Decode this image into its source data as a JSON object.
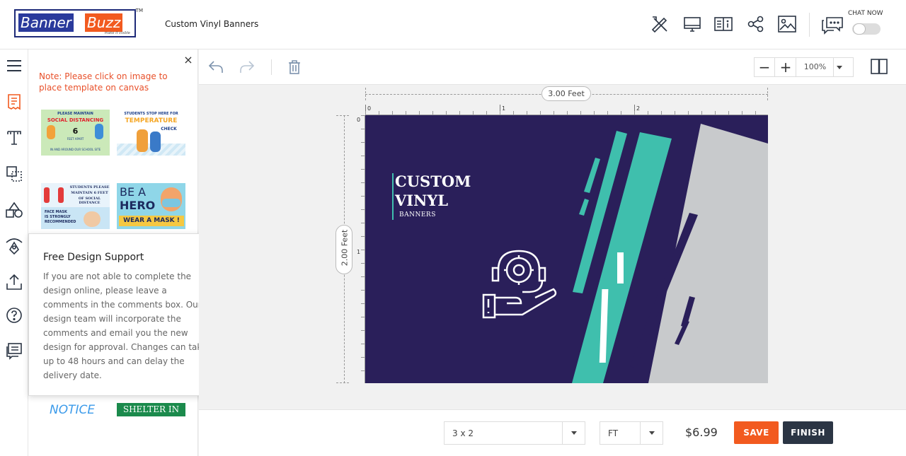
{
  "header": {
    "logo_word1": "Banner",
    "logo_word2": "Buzz",
    "logo_tagline": "make it visible",
    "logo_tm": "TM",
    "title": "Custom Vinyl Banners",
    "chat_label": "CHAT NOW",
    "icons": [
      "design-tools-icon",
      "monitor-icon",
      "book-info-icon",
      "share-icon",
      "image-icon",
      "chat-icon"
    ]
  },
  "rail": {
    "icons": [
      "menu-icon",
      "templates-icon",
      "text-icon",
      "layers-icon",
      "shapes-icon",
      "clipart-icon",
      "upload-icon",
      "help-icon",
      "comments-icon"
    ]
  },
  "template_panel": {
    "note": "Note: Please click on image to place template on canvas",
    "thumbs": [
      {
        "lines": [
          "PLEASE MAINTAIN",
          "SOCIAL DISTANCING",
          "6",
          "FEET APART",
          "IN AND AROUND OUR SCHOOL SITE"
        ]
      },
      {
        "lines": [
          "STUDENTS STOP HERE FOR",
          "TEMPERATURE",
          "CHECK"
        ]
      },
      {
        "lines": [
          "STUDENTS PLEASE",
          "MAINTAIN 6 FEET",
          "OF SOCIAL DISTANCE",
          "FACE MASK",
          "IS STRONGLY",
          "RECOMMENDED"
        ]
      },
      {
        "lines": [
          "BE A",
          "HERO",
          "WEAR A MASK !"
        ]
      },
      {
        "lines": [
          "NOTICE"
        ]
      },
      {
        "lines": [
          "SHELTER IN"
        ]
      }
    ]
  },
  "popup": {
    "title": "Free Design Support",
    "body": "If you are not able to complete the design online, please leave a comments in the comments box. Our design team will incorporate the comments and email you the new design for approval. Changes can take up to 48 hours and can delay the delivery date."
  },
  "toolbar": {
    "zoom_value": "100%",
    "zoom_minus": "−",
    "zoom_plus": "+"
  },
  "canvas": {
    "width_label": "3.00 Feet",
    "height_label": "2.00 Feet",
    "h_ticks": [
      "0",
      "1",
      "2"
    ],
    "v_ticks": [
      "0",
      "1"
    ],
    "banner_title_1": "CUSTOM",
    "banner_title_2": "VINYL",
    "banner_sub": "BANNERS",
    "colors": {
      "background": "#2a1f5a",
      "teal": "#3fbfad",
      "gray": "#c8cacc"
    }
  },
  "footer": {
    "size_value": "3 x 2",
    "unit_value": "FT",
    "price": "$6.99",
    "save_label": "SAVE",
    "finish_label": "FINISH"
  }
}
